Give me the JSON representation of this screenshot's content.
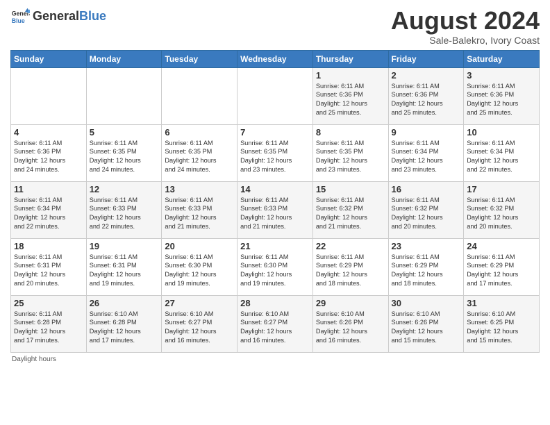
{
  "header": {
    "logo_general": "General",
    "logo_blue": "Blue",
    "month_title": "August 2024",
    "subtitle": "Sale-Balekro, Ivory Coast"
  },
  "days_of_week": [
    "Sunday",
    "Monday",
    "Tuesday",
    "Wednesday",
    "Thursday",
    "Friday",
    "Saturday"
  ],
  "weeks": [
    [
      {
        "num": "",
        "info": ""
      },
      {
        "num": "",
        "info": ""
      },
      {
        "num": "",
        "info": ""
      },
      {
        "num": "",
        "info": ""
      },
      {
        "num": "1",
        "info": "Sunrise: 6:11 AM\nSunset: 6:36 PM\nDaylight: 12 hours\nand 25 minutes."
      },
      {
        "num": "2",
        "info": "Sunrise: 6:11 AM\nSunset: 6:36 PM\nDaylight: 12 hours\nand 25 minutes."
      },
      {
        "num": "3",
        "info": "Sunrise: 6:11 AM\nSunset: 6:36 PM\nDaylight: 12 hours\nand 25 minutes."
      }
    ],
    [
      {
        "num": "4",
        "info": "Sunrise: 6:11 AM\nSunset: 6:36 PM\nDaylight: 12 hours\nand 24 minutes."
      },
      {
        "num": "5",
        "info": "Sunrise: 6:11 AM\nSunset: 6:35 PM\nDaylight: 12 hours\nand 24 minutes."
      },
      {
        "num": "6",
        "info": "Sunrise: 6:11 AM\nSunset: 6:35 PM\nDaylight: 12 hours\nand 24 minutes."
      },
      {
        "num": "7",
        "info": "Sunrise: 6:11 AM\nSunset: 6:35 PM\nDaylight: 12 hours\nand 23 minutes."
      },
      {
        "num": "8",
        "info": "Sunrise: 6:11 AM\nSunset: 6:35 PM\nDaylight: 12 hours\nand 23 minutes."
      },
      {
        "num": "9",
        "info": "Sunrise: 6:11 AM\nSunset: 6:34 PM\nDaylight: 12 hours\nand 23 minutes."
      },
      {
        "num": "10",
        "info": "Sunrise: 6:11 AM\nSunset: 6:34 PM\nDaylight: 12 hours\nand 22 minutes."
      }
    ],
    [
      {
        "num": "11",
        "info": "Sunrise: 6:11 AM\nSunset: 6:34 PM\nDaylight: 12 hours\nand 22 minutes."
      },
      {
        "num": "12",
        "info": "Sunrise: 6:11 AM\nSunset: 6:33 PM\nDaylight: 12 hours\nand 22 minutes."
      },
      {
        "num": "13",
        "info": "Sunrise: 6:11 AM\nSunset: 6:33 PM\nDaylight: 12 hours\nand 21 minutes."
      },
      {
        "num": "14",
        "info": "Sunrise: 6:11 AM\nSunset: 6:33 PM\nDaylight: 12 hours\nand 21 minutes."
      },
      {
        "num": "15",
        "info": "Sunrise: 6:11 AM\nSunset: 6:32 PM\nDaylight: 12 hours\nand 21 minutes."
      },
      {
        "num": "16",
        "info": "Sunrise: 6:11 AM\nSunset: 6:32 PM\nDaylight: 12 hours\nand 20 minutes."
      },
      {
        "num": "17",
        "info": "Sunrise: 6:11 AM\nSunset: 6:32 PM\nDaylight: 12 hours\nand 20 minutes."
      }
    ],
    [
      {
        "num": "18",
        "info": "Sunrise: 6:11 AM\nSunset: 6:31 PM\nDaylight: 12 hours\nand 20 minutes."
      },
      {
        "num": "19",
        "info": "Sunrise: 6:11 AM\nSunset: 6:31 PM\nDaylight: 12 hours\nand 19 minutes."
      },
      {
        "num": "20",
        "info": "Sunrise: 6:11 AM\nSunset: 6:30 PM\nDaylight: 12 hours\nand 19 minutes."
      },
      {
        "num": "21",
        "info": "Sunrise: 6:11 AM\nSunset: 6:30 PM\nDaylight: 12 hours\nand 19 minutes."
      },
      {
        "num": "22",
        "info": "Sunrise: 6:11 AM\nSunset: 6:29 PM\nDaylight: 12 hours\nand 18 minutes."
      },
      {
        "num": "23",
        "info": "Sunrise: 6:11 AM\nSunset: 6:29 PM\nDaylight: 12 hours\nand 18 minutes."
      },
      {
        "num": "24",
        "info": "Sunrise: 6:11 AM\nSunset: 6:29 PM\nDaylight: 12 hours\nand 17 minutes."
      }
    ],
    [
      {
        "num": "25",
        "info": "Sunrise: 6:11 AM\nSunset: 6:28 PM\nDaylight: 12 hours\nand 17 minutes."
      },
      {
        "num": "26",
        "info": "Sunrise: 6:10 AM\nSunset: 6:28 PM\nDaylight: 12 hours\nand 17 minutes."
      },
      {
        "num": "27",
        "info": "Sunrise: 6:10 AM\nSunset: 6:27 PM\nDaylight: 12 hours\nand 16 minutes."
      },
      {
        "num": "28",
        "info": "Sunrise: 6:10 AM\nSunset: 6:27 PM\nDaylight: 12 hours\nand 16 minutes."
      },
      {
        "num": "29",
        "info": "Sunrise: 6:10 AM\nSunset: 6:26 PM\nDaylight: 12 hours\nand 16 minutes."
      },
      {
        "num": "30",
        "info": "Sunrise: 6:10 AM\nSunset: 6:26 PM\nDaylight: 12 hours\nand 15 minutes."
      },
      {
        "num": "31",
        "info": "Sunrise: 6:10 AM\nSunset: 6:25 PM\nDaylight: 12 hours\nand 15 minutes."
      }
    ]
  ],
  "footer": {
    "daylight_label": "Daylight hours"
  }
}
